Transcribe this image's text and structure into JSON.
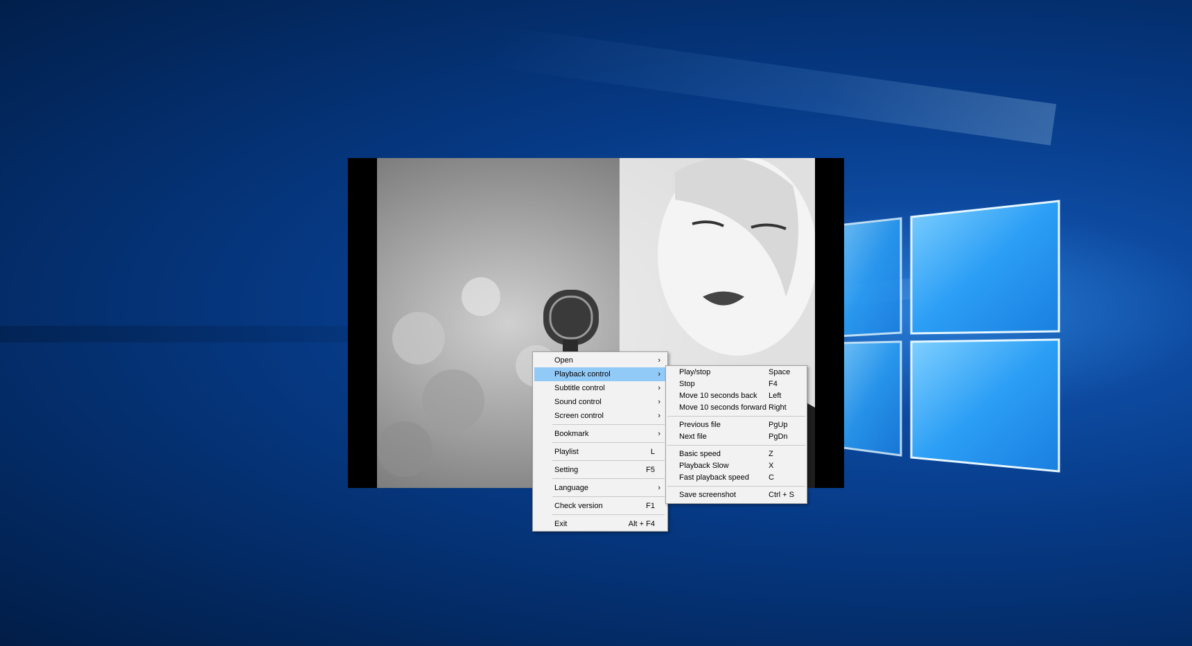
{
  "menu": {
    "items": [
      {
        "label": "Open",
        "shortcut": "",
        "submenu": true
      },
      {
        "label": "Playback control",
        "shortcut": "",
        "submenu": true,
        "highlighted": true
      },
      {
        "label": "Subtitle control",
        "shortcut": "",
        "submenu": true
      },
      {
        "label": "Sound control",
        "shortcut": "",
        "submenu": true
      },
      {
        "label": "Screen control",
        "shortcut": "",
        "submenu": true
      },
      {
        "label": "Bookmark",
        "shortcut": "",
        "submenu": true
      },
      {
        "label": "Playlist",
        "shortcut": "L",
        "submenu": false
      },
      {
        "label": "Setting",
        "shortcut": "F5",
        "submenu": false
      },
      {
        "label": "Language",
        "shortcut": "",
        "submenu": true
      },
      {
        "label": "Check version",
        "shortcut": "F1",
        "submenu": false
      },
      {
        "label": "Exit",
        "shortcut": "Alt + F4",
        "submenu": false
      }
    ],
    "submenu_arrow": "›"
  },
  "playback_submenu": {
    "items": [
      {
        "label": "Play/stop",
        "shortcut": "Space"
      },
      {
        "label": "Stop",
        "shortcut": "F4"
      },
      {
        "label": "Move 10 seconds back",
        "shortcut": "Left"
      },
      {
        "label": "Move 10 seconds forward",
        "shortcut": "Right"
      },
      {
        "label": "Previous file",
        "shortcut": "PgUp"
      },
      {
        "label": "Next file",
        "shortcut": "PgDn"
      },
      {
        "label": "Basic speed",
        "shortcut": "Z"
      },
      {
        "label": "Playback Slow",
        "shortcut": "X"
      },
      {
        "label": "Fast playback speed",
        "shortcut": "C"
      },
      {
        "label": "Save screenshot",
        "shortcut": "Ctrl + S"
      }
    ]
  },
  "colors": {
    "highlight": "#91c9f7",
    "menu_bg": "#f2f2f2",
    "desktop_blue": "#063a86"
  },
  "icons": {
    "desktop": "windows-logo",
    "video": "video-frame-singer-with-microphone"
  }
}
